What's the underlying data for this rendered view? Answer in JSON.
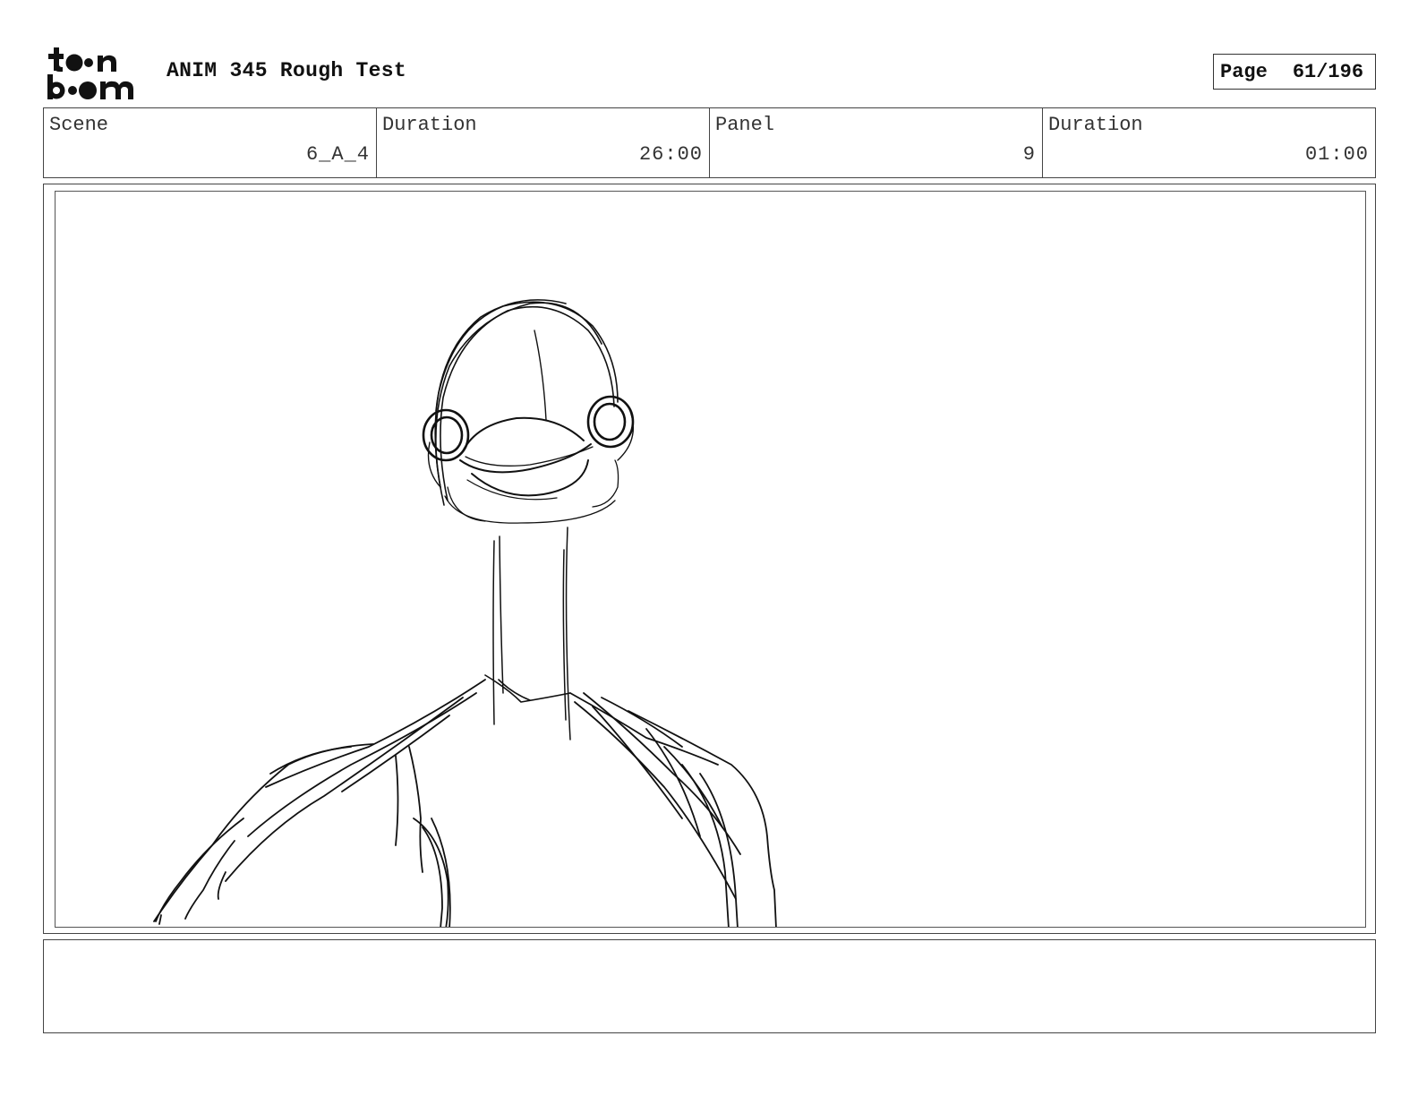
{
  "header": {
    "logo_text": "toon boom",
    "project_title": "ANIM 345 Rough Test",
    "page_label": "Page",
    "page_value": "61/196"
  },
  "info": {
    "scene_label": "Scene",
    "scene_value": "6_A_4",
    "scene_duration_label": "Duration",
    "scene_duration_value": "26:00",
    "panel_label": "Panel",
    "panel_value": "9",
    "panel_duration_label": "Duration",
    "panel_duration_value": "01:00"
  },
  "notes": {
    "text": ""
  }
}
